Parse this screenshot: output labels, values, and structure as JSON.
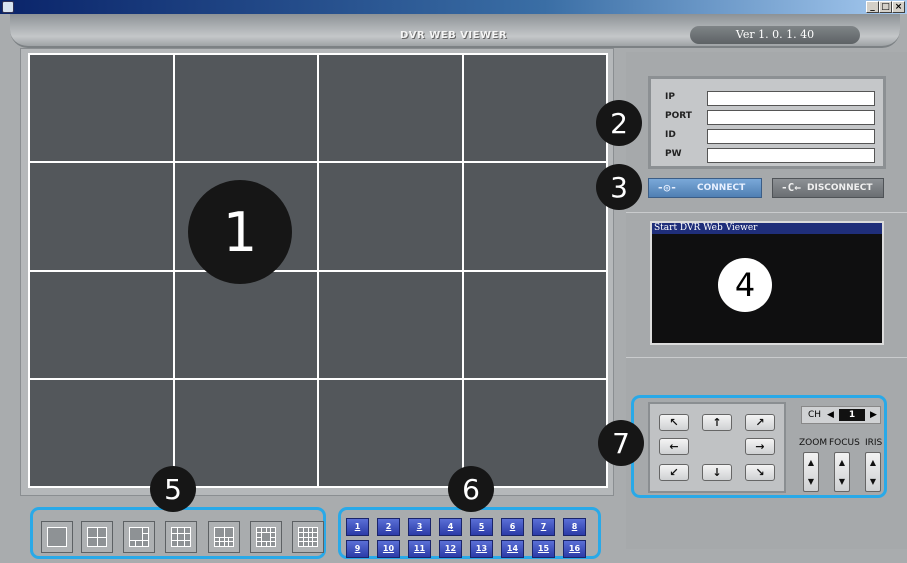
{
  "window": {
    "min_label": "_",
    "max_label": "□",
    "close_label": "×"
  },
  "header": {
    "title": "DVR WEB VIEWER",
    "version": "Ver 1. 0. 1. 40"
  },
  "callouts": [
    "1",
    "2",
    "3",
    "4",
    "5",
    "6",
    "7"
  ],
  "connection": {
    "fields": [
      {
        "label": "IP",
        "value": ""
      },
      {
        "label": "PORT",
        "value": ""
      },
      {
        "label": "ID",
        "value": ""
      },
      {
        "label": "PW",
        "value": ""
      }
    ],
    "connect_label": "CONNECT",
    "connect_icon": "plug-connect-icon",
    "disconnect_label": "DISCONNECT",
    "disconnect_icon": "plug-disconnect-icon"
  },
  "log": {
    "title": "Start DVR Web Viewer"
  },
  "ptz": {
    "arrows": {
      "up_left": "↖",
      "up": "↑",
      "up_right": "↗",
      "left": "←",
      "right": "→",
      "down_left": "↙",
      "down": "↓",
      "down_right": "↘"
    },
    "channel_label": "CH",
    "channel_prev": "◀",
    "channel_next": "▶",
    "channel_value": "1",
    "lens": [
      {
        "label": "ZOOM",
        "up": "▲",
        "down": "▼"
      },
      {
        "label": "FOCUS",
        "up": "▲",
        "down": "▼"
      },
      {
        "label": "IRIS",
        "up": "▲",
        "down": "▼"
      }
    ]
  },
  "layout_buttons": [
    "1-split",
    "4-split",
    "6-split",
    "9-split",
    "10-split",
    "13-split",
    "16-split"
  ],
  "channels": [
    "1",
    "2",
    "3",
    "4",
    "5",
    "6",
    "7",
    "8",
    "9",
    "10",
    "11",
    "12",
    "13",
    "14",
    "15",
    "16"
  ],
  "colors": {
    "callout_border": "#29a9e8",
    "connect_button": "#5f8fc6",
    "channel_button": "#3447b5",
    "video_cell": "#53575b"
  }
}
